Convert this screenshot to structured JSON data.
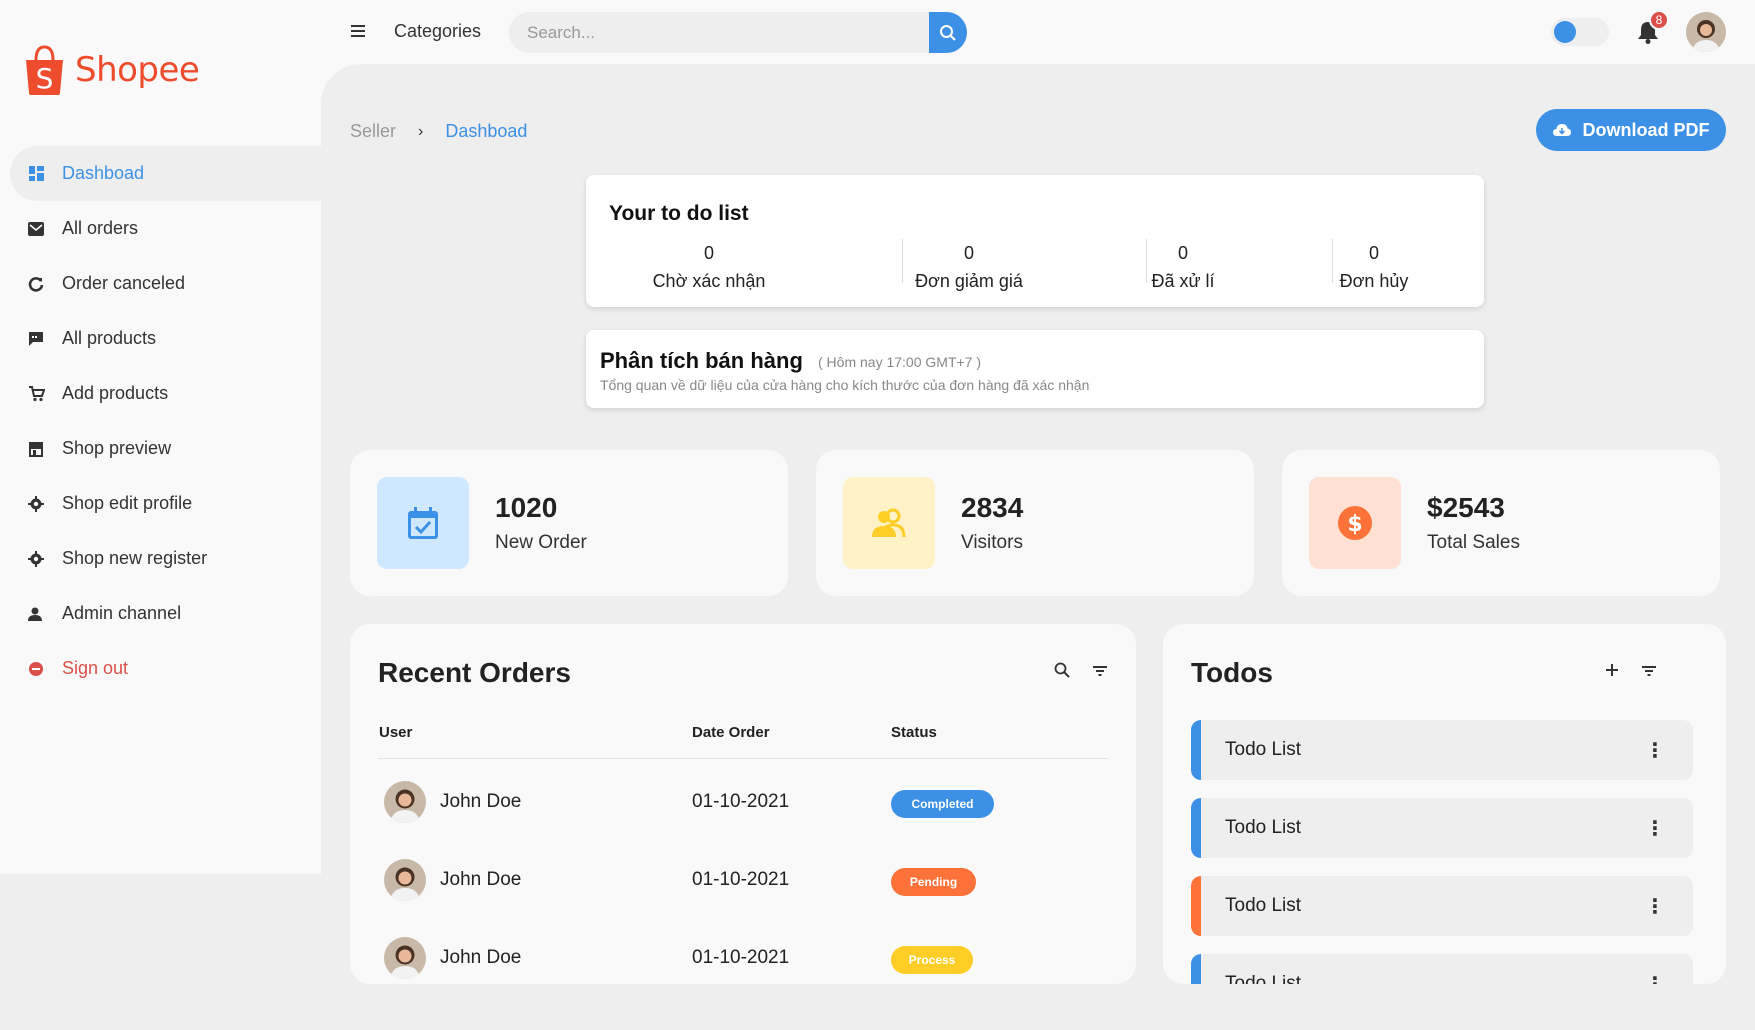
{
  "brand": {
    "name": "Shopee",
    "color": "#ee4d2d",
    "accent": "#3c91e6"
  },
  "sidebar": {
    "items": [
      {
        "label": "Dashboad",
        "icon": "dashboard-icon",
        "active": true
      },
      {
        "label": "All orders",
        "icon": "mail-icon"
      },
      {
        "label": "Order canceled",
        "icon": "refresh-icon"
      },
      {
        "label": "All products",
        "icon": "message-icon"
      },
      {
        "label": "Add products",
        "icon": "cart-add-icon"
      },
      {
        "label": "Shop preview",
        "icon": "store-icon"
      },
      {
        "label": "Shop edit profile",
        "icon": "gear-icon"
      },
      {
        "label": "Shop new register",
        "icon": "gear-icon"
      },
      {
        "label": "Admin channel",
        "icon": "user-icon"
      },
      {
        "label": "Sign out",
        "icon": "logout-icon"
      }
    ]
  },
  "topnav": {
    "categories": "Categories",
    "search_placeholder": "Search...",
    "notification_count": "8"
  },
  "breadcrumb": {
    "parent": "Seller",
    "current": "Dashboad"
  },
  "download_button": "Download PDF",
  "todo_summary": {
    "title": "Your to do list",
    "stats": [
      {
        "value": "0",
        "label": "Chờ xác nhận"
      },
      {
        "value": "0",
        "label": "Đơn giảm giá"
      },
      {
        "value": "0",
        "label": "Đã xử lí"
      },
      {
        "value": "0",
        "label": "Đơn hủy"
      }
    ]
  },
  "analytics": {
    "title": "Phân tích bán hàng",
    "time": "( Hôm nay 17:00 GMT+7 )",
    "subtitle": "Tổng quan về dữ liệu của cửa hàng cho kích thước của đơn hàng đã xác nhận"
  },
  "boxes": [
    {
      "value": "1020",
      "label": "New Order",
      "icon": "calendar-check-icon",
      "bg": "#cfe8ff",
      "color": "#3c91e6"
    },
    {
      "value": "2834",
      "label": "Visitors",
      "icon": "group-icon",
      "bg": "#fff2c6",
      "color": "#ffce26"
    },
    {
      "value": "$2543",
      "label": "Total Sales",
      "icon": "dollar-circle-icon",
      "bg": "#ffe0d3",
      "color": "#fd7238"
    }
  ],
  "orders": {
    "title": "Recent Orders",
    "columns": [
      "User",
      "Date Order",
      "Status"
    ],
    "rows": [
      {
        "user": "John Doe",
        "date": "01-10-2021",
        "status": "Completed",
        "color": "#3c91e6"
      },
      {
        "user": "John Doe",
        "date": "01-10-2021",
        "status": "Pending",
        "color": "#fd7238"
      },
      {
        "user": "John Doe",
        "date": "01-10-2021",
        "status": "Process",
        "color": "#ffce26"
      }
    ]
  },
  "todos": {
    "title": "Todos",
    "items": [
      {
        "text": "Todo List",
        "color": "#3c91e6"
      },
      {
        "text": "Todo List",
        "color": "#3c91e6"
      },
      {
        "text": "Todo List",
        "color": "#fd7238"
      },
      {
        "text": "Todo List",
        "color": "#3c91e6"
      }
    ]
  }
}
